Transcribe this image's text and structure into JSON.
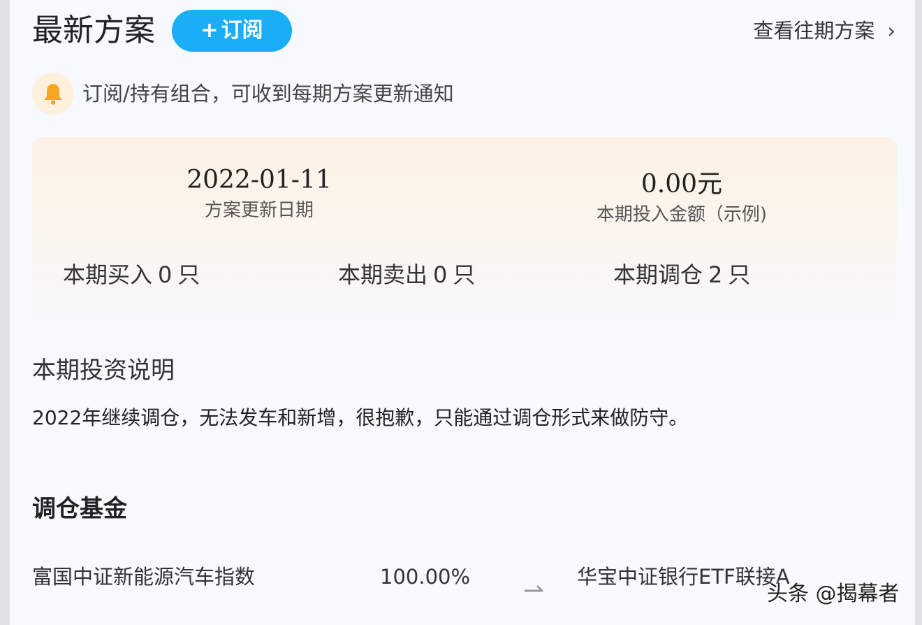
{
  "header": {
    "title": "最新方案",
    "subscribe_plus": "+",
    "subscribe_label": "订阅",
    "history_link": "查看往期方案",
    "history_chevron": "›"
  },
  "notice": {
    "icon": "bell-icon",
    "text": "订阅/持有组合，可收到每期方案更新通知",
    "icon_bg": "#fdf1dc",
    "icon_color": "#f5a623"
  },
  "summary": {
    "update_date": "2022-01-11",
    "update_date_label": "方案更新日期",
    "amount": "0.00元",
    "amount_label": "本期投入金额（示例)",
    "buy_prefix": "本期买入",
    "buy_count": "0",
    "sell_prefix": "本期卖出",
    "sell_count": "0",
    "rebalance_prefix": "本期调仓",
    "rebalance_count": "2",
    "unit": "只"
  },
  "investment_note": {
    "title": "本期投资说明",
    "text": "2022年继续调仓，无法发车和新增，很抱歉，只能通过调仓形式来做防守。"
  },
  "rebalance": {
    "title": "调仓基金",
    "rows": [
      {
        "from": "富国中证新能源汽车指数",
        "percent": "100.00%",
        "arrow_icon": "arrow-right-icon",
        "to": "华宝中证银行ETF联接A"
      }
    ]
  },
  "watermark": "头条 @揭幕者",
  "colors": {
    "accent": "#19aef5",
    "background": "#f6f9fd"
  }
}
